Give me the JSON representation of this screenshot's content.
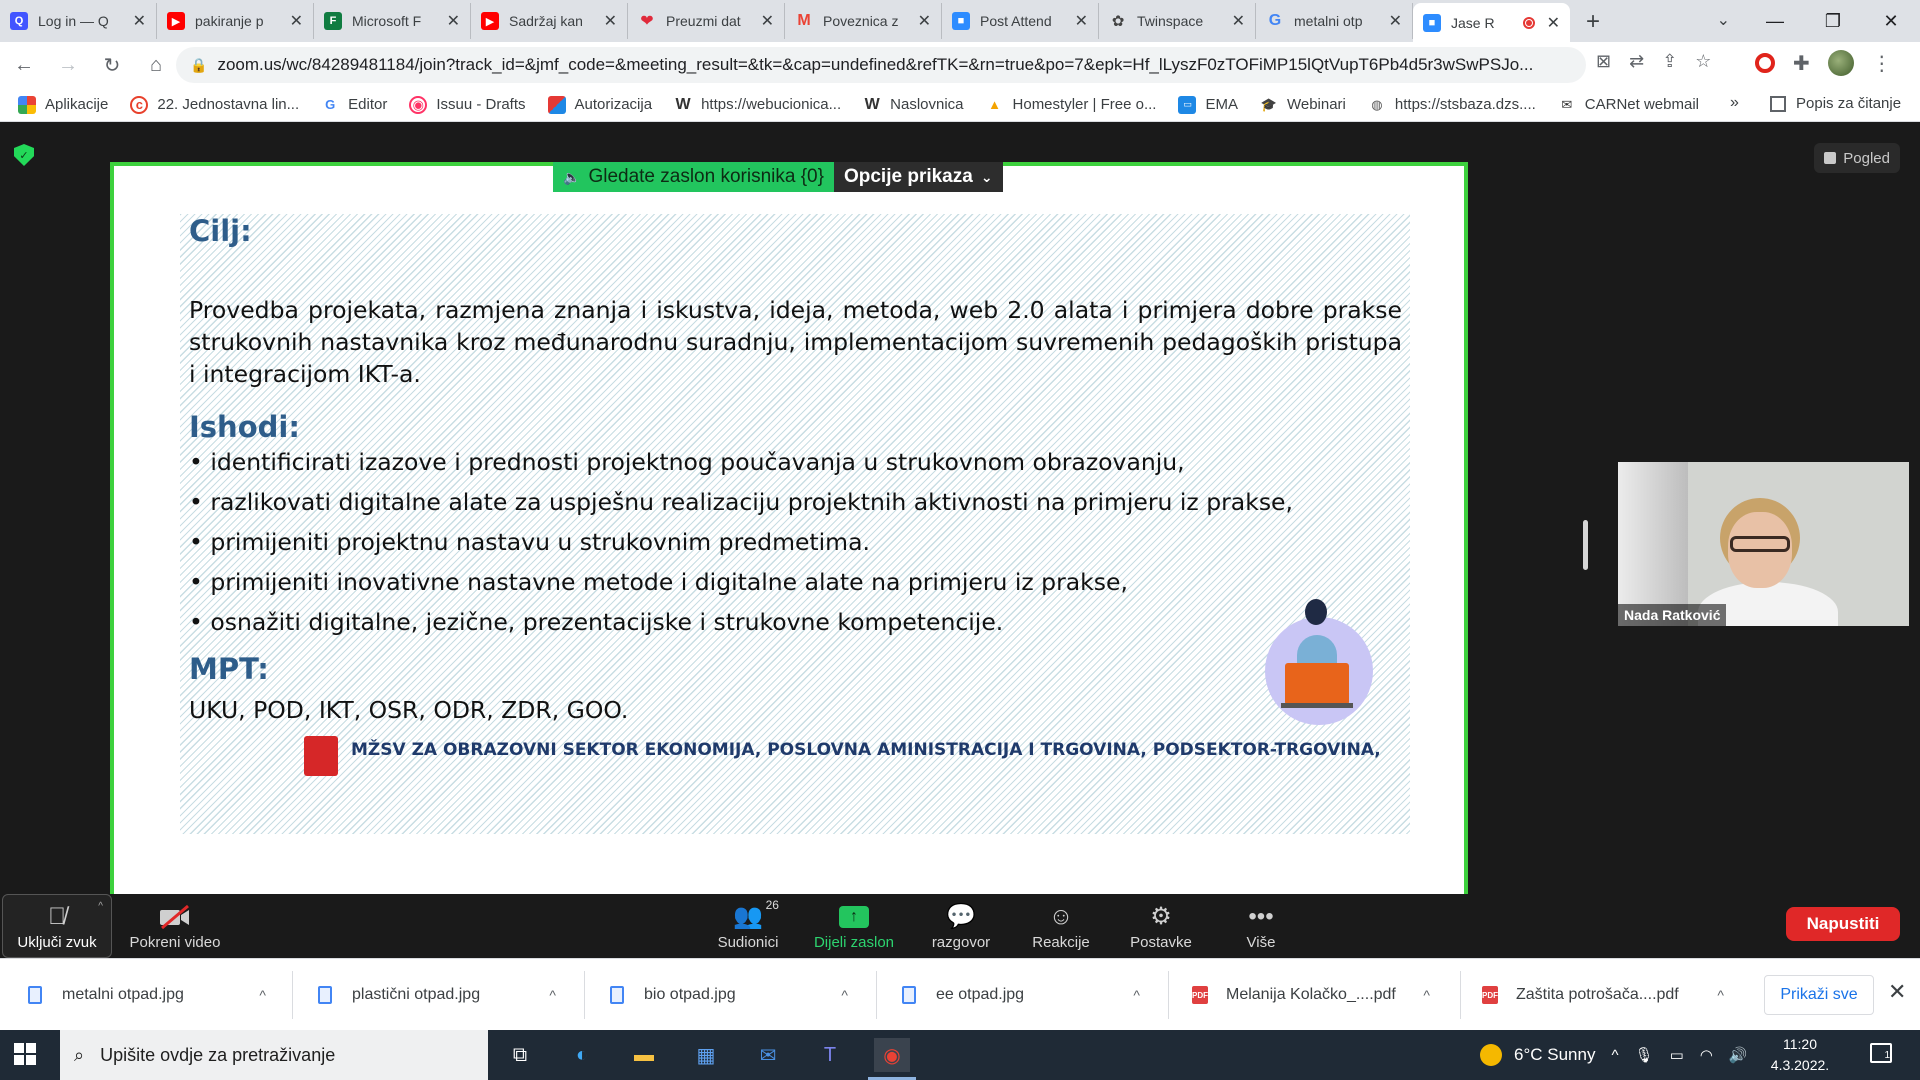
{
  "browser": {
    "tabs": [
      {
        "title": "Log in — Q",
        "icon": "quizlet-icon",
        "color": "#4255ff"
      },
      {
        "title": "pakiranje p",
        "icon": "youtube-icon",
        "color": "#ff0000"
      },
      {
        "title": "Microsoft F",
        "icon": "forms-icon",
        "color": "#107c41"
      },
      {
        "title": "Sadržaj kan",
        "icon": "youtube-icon",
        "color": "#ff0000"
      },
      {
        "title": "Preuzmi dat",
        "icon": "heart-icon",
        "color": "#e02a3b"
      },
      {
        "title": "Poveznica z",
        "icon": "gmail-icon",
        "color": "#ea4335"
      },
      {
        "title": "Post Attend",
        "icon": "zoom-icon",
        "color": "#2d8cff"
      },
      {
        "title": "Twinspace",
        "icon": "twinspace-icon",
        "color": "#444444"
      },
      {
        "title": "metalni otp",
        "icon": "google-icon",
        "color": "#4285f4"
      },
      {
        "title": "Jase R",
        "icon": "zoom-icon",
        "color": "#2d8cff",
        "active": true
      }
    ],
    "url": "zoom.us/wc/84289481184/join?track_id=&jmf_code=&meeting_result=&tk=&cap=undefined&refTK=&rn=true&po=7&epk=Hf_lLyszF0zTOFiMP15lQtVupT6Pb4d5r3wSwPSJo...",
    "bookmarks": [
      {
        "label": "Aplikacije",
        "icon": "apps-grid-icon"
      },
      {
        "label": "22. Jednostavna lin...",
        "icon": "c-logo-icon"
      },
      {
        "label": "Editor",
        "icon": "google-g-icon"
      },
      {
        "label": "Issuu - Drafts",
        "icon": "issuu-icon"
      },
      {
        "label": "Autorizacija",
        "icon": "tile-icon"
      },
      {
        "label": "https://webucionica...",
        "icon": "w-icon"
      },
      {
        "label": "Naslovnica",
        "icon": "w-icon"
      },
      {
        "label": "Homestyler | Free o...",
        "icon": "homestyler-icon"
      },
      {
        "label": "EMA",
        "icon": "ema-icon"
      },
      {
        "label": "Webinari",
        "icon": "graduation-cap-icon"
      },
      {
        "label": "https://stsbaza.dzs....",
        "icon": "globe-icon"
      },
      {
        "label": "CARNet webmail",
        "icon": "mail-icon"
      }
    ],
    "bookmarks_more": "»",
    "reading_list": "Popis za čitanje"
  },
  "zoom": {
    "view_button": "Pogled",
    "share_banner": "Gledate zaslon korisnika {0}",
    "view_options": "Opcije prikaza",
    "participant_name": "Nada Ratković",
    "controls": {
      "mute": "Uključi zvuk",
      "video": "Pokreni video",
      "participants": "Sudionici",
      "participants_count": "26",
      "share": "Dijeli zaslon",
      "chat": "razgovor",
      "reactions": "Reakcije",
      "settings": "Postavke",
      "more": "Više",
      "leave": "Napustiti"
    }
  },
  "slide": {
    "goal_heading": "Cilj:",
    "goal_text": "Provedba projekata, razmjena znanja i iskustva, ideja, metoda, web 2.0 alata i primjera dobre prakse strukovnih nastavnika kroz međunarodnu suradnju, implementacijom suvremenih pedagoških pristupa i integracijom IKT-a.",
    "outcomes_heading": "Ishodi:",
    "outcomes": [
      "identificirati izazove i prednosti projektnog poučavanja u strukovnom obrazovanju,",
      "razlikovati digitalne alate za uspješnu realizaciju projektnih aktivnosti na primjeru iz prakse,",
      "primijeniti projektnu nastavu u strukovnim predmetima.",
      "primijeniti inovativne nastavne metode i digitalne alate na primjeru iz prakse,",
      "osnažiti digitalne, jezične, prezentacijske i strukovne kompetencije."
    ],
    "mpt_heading": "MPT:",
    "mpt_text": "UKU, POD, IKT, OSR, ODR, ZDR, GOO.",
    "footer": "MŽSV ZA OBRAZOVNI SEKTOR EKONOMIJA, POSLOVNA AMINISTRACIJA I TRGOVINA, PODSEKTOR-TRGOVINA,"
  },
  "downloads": {
    "items": [
      {
        "name": "metalni otpad.jpg",
        "type": "image"
      },
      {
        "name": "plastični otpad.jpg",
        "type": "image"
      },
      {
        "name": "bio otpad.jpg",
        "type": "image"
      },
      {
        "name": "ee otpad.jpg",
        "type": "image"
      },
      {
        "name": "Melanija Kolačko_....pdf",
        "type": "pdf"
      },
      {
        "name": "Zaštita potrošača....pdf",
        "type": "pdf"
      }
    ],
    "show_all": "Prikaži sve"
  },
  "taskbar": {
    "search_placeholder": "Upišite ovdje za pretraživanje",
    "weather": "6°C  Sunny",
    "time": "11:20",
    "date": "4.3.2022.",
    "notifications": "1"
  }
}
